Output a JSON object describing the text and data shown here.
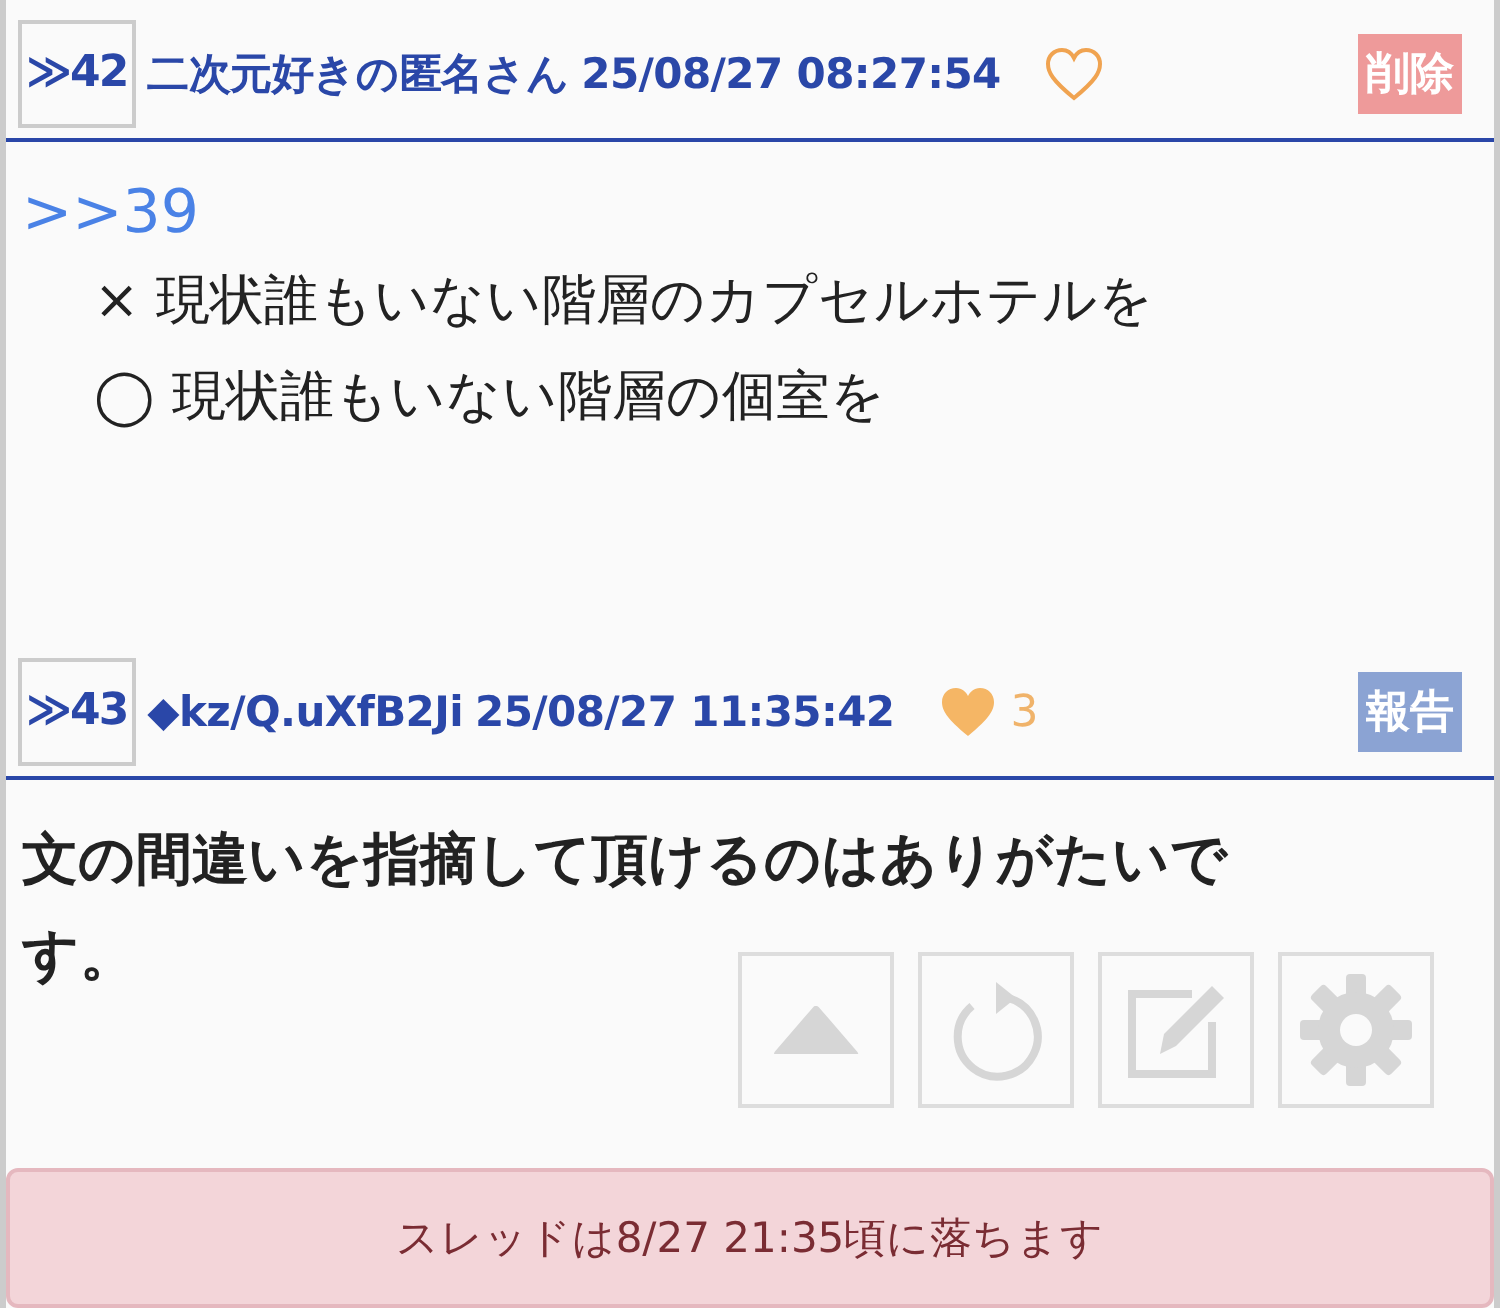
{
  "posts": [
    {
      "number": "≫42",
      "author": "二次元好きの匿名さん",
      "date": "25/08/27 08:27:54",
      "liked": false,
      "action": {
        "kind": "delete",
        "label": "削除"
      },
      "anchor": ">>39",
      "lines": [
        "× 現状誰もいない階層のカプセルホテルを",
        "◯ 現状誰もいない階層の個室を"
      ],
      "bold": false
    },
    {
      "number": "≫43",
      "author": "◆kz/Q.uXfB2Ji",
      "date": "25/08/27 11:35:42",
      "liked": true,
      "likes": "3",
      "action": {
        "kind": "report",
        "label": "報告"
      },
      "lines": [
        "文の間違いを指摘して頂けるのはありがたいです。"
      ],
      "bold": true
    }
  ],
  "toolbar": [
    {
      "kind": "up"
    },
    {
      "kind": "reload"
    },
    {
      "kind": "edit"
    },
    {
      "kind": "settings"
    }
  ],
  "notice": "スレッドは8/27 21:35頃に落ちます"
}
